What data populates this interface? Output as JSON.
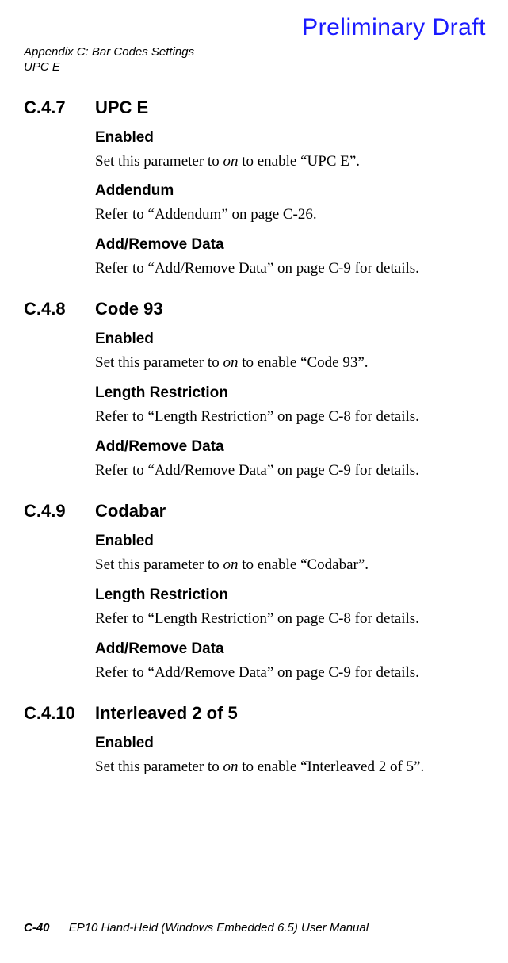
{
  "watermark": "Preliminary Draft",
  "header": {
    "line1": "Appendix C: Bar Codes Settings",
    "line2": "UPC E"
  },
  "sections": [
    {
      "number": "C.4.7",
      "title": "UPC E",
      "subs": [
        {
          "heading": "Enabled",
          "text_pre": "Set this parameter to ",
          "text_em": "on",
          "text_post": " to enable “UPC E”."
        },
        {
          "heading": "Addendum",
          "text_pre": "Refer to “Addendum” on page C-26.",
          "text_em": "",
          "text_post": ""
        },
        {
          "heading": "Add/Remove Data",
          "text_pre": "Refer to “Add/Remove Data” on page C-9 for details.",
          "text_em": "",
          "text_post": ""
        }
      ]
    },
    {
      "number": "C.4.8",
      "title": "Code 93",
      "subs": [
        {
          "heading": "Enabled",
          "text_pre": "Set this parameter to ",
          "text_em": "on",
          "text_post": " to enable “Code 93”."
        },
        {
          "heading": "Length Restriction",
          "text_pre": "Refer to “Length Restriction” on page C-8 for details.",
          "text_em": "",
          "text_post": ""
        },
        {
          "heading": "Add/Remove Data",
          "text_pre": "Refer to “Add/Remove Data” on page C-9 for details.",
          "text_em": "",
          "text_post": ""
        }
      ]
    },
    {
      "number": "C.4.9",
      "title": " Codabar",
      "subs": [
        {
          "heading": "Enabled",
          "text_pre": "Set this parameter to ",
          "text_em": "on",
          "text_post": " to enable “Codabar”."
        },
        {
          "heading": "Length Restriction",
          "text_pre": "Refer to “Length Restriction” on page C-8 for details.",
          "text_em": "",
          "text_post": ""
        },
        {
          "heading": "Add/Remove Data",
          "text_pre": "Refer to “Add/Remove Data” on page C-9 for details.",
          "text_em": "",
          "text_post": ""
        }
      ]
    },
    {
      "number": "C.4.10",
      "title": " Interleaved 2 of 5",
      "subs": [
        {
          "heading": "Enabled",
          "text_pre": "Set this parameter to ",
          "text_em": "on",
          "text_post": " to enable “Interleaved 2 of 5”."
        }
      ]
    }
  ],
  "footer": {
    "page": "C-40",
    "title": "EP10 Hand-Held (Windows Embedded 6.5) User Manual"
  }
}
